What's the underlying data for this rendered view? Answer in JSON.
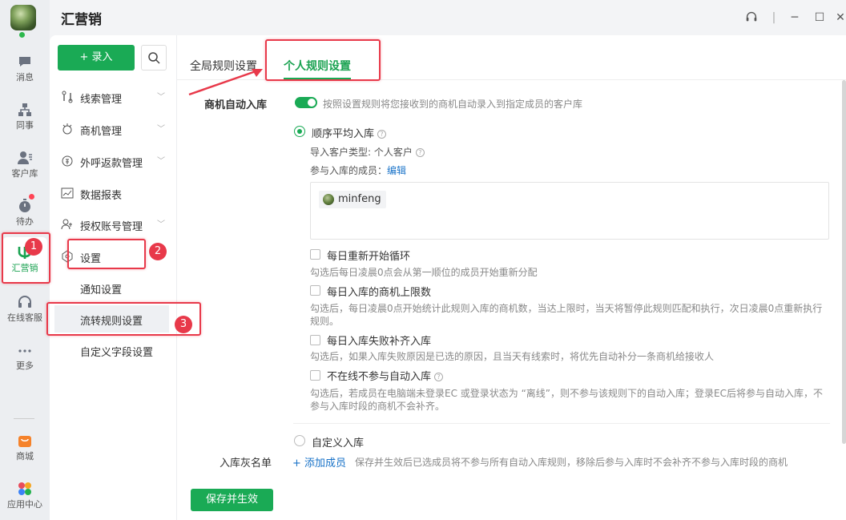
{
  "app_title": "汇营销",
  "rail": {
    "items": [
      {
        "label": "消息",
        "icon": "chat-bubble-icon"
      },
      {
        "label": "同事",
        "icon": "org-chart-icon"
      },
      {
        "label": "客户库",
        "icon": "customer-icon"
      },
      {
        "label": "待办",
        "icon": "stopwatch-icon"
      },
      {
        "label": "汇营销",
        "icon": "huiyingxiao-icon"
      },
      {
        "label": "在线客服",
        "icon": "headset-icon"
      },
      {
        "label": "更多",
        "icon": "more-dots-icon"
      },
      {
        "label": "商城",
        "icon": "shop-icon"
      },
      {
        "label": "应用中心",
        "icon": "app-grid-icon"
      }
    ]
  },
  "nav": {
    "entry_label": "+ 录入",
    "items": [
      {
        "label": "线索管理",
        "icon": "lead-icon"
      },
      {
        "label": "商机管理",
        "icon": "opportunity-icon"
      },
      {
        "label": "外呼返款管理",
        "icon": "refund-icon"
      },
      {
        "label": "数据报表",
        "icon": "chart-icon"
      },
      {
        "label": "授权账号管理",
        "icon": "account-icon"
      },
      {
        "label": "设置",
        "icon": "settings-icon"
      }
    ],
    "sub_items": [
      {
        "label": "通知设置"
      },
      {
        "label": "流转规则设置"
      },
      {
        "label": "自定义字段设置"
      }
    ]
  },
  "tabs": [
    {
      "label": "全局规则设置"
    },
    {
      "label": "个人规则设置"
    }
  ],
  "form": {
    "auto_label": "商机自动入库",
    "auto_hint": "按照设置规则将您接收到的商机自动录入到指定成员的客户库",
    "mode_seq": "顺序平均入库",
    "import_type": "导入客户类型: 个人客户",
    "members_label": "参与入库的成员：",
    "members_edit": "编辑",
    "member_name": "minfeng",
    "opt1": "每日重新开始循环",
    "opt1_hint": "勾选后每日凌晨0点会从第一顺位的成员开始重新分配",
    "opt2": "每日入库的商机上限数",
    "opt2_hint_a": "勾选后，每日凌晨0点开始统计此规则入库的商机数，当达上限时，当天将暂停此规则匹配和执行，次日凌晨0点重新执行",
    "opt2_hint_b": "规则。",
    "opt3": "每日入库失败补齐入库",
    "opt3_hint": "勾选后，如果入库失败原因是已选的原因，且当天有线索时，将优先自动补分一条商机给接收人",
    "opt4": "不在线不参与自动入库",
    "opt4_hint_a": "勾选后，若成员在电脑端未登录EC 或登录状态为 “离线”，则不参与该规则下的自动入库；登录EC后将参与自动入库，不",
    "opt4_hint_b": "参与入库时段的商机不会补齐。",
    "mode_custom": "自定义入库",
    "greylist_label": "入库灰名单",
    "add_member": "+ 添加成员",
    "greylist_hint": "保存并生效后已选成员将不参与所有自动入库规则，移除后参与入库时不会补齐不参与入库时段的商机",
    "save_label": "保存并生效"
  },
  "annotations": [
    "1",
    "2",
    "3"
  ],
  "colors": {
    "accent": "#1aaa55",
    "annotation": "#e8394a",
    "link": "#1a73c8"
  }
}
